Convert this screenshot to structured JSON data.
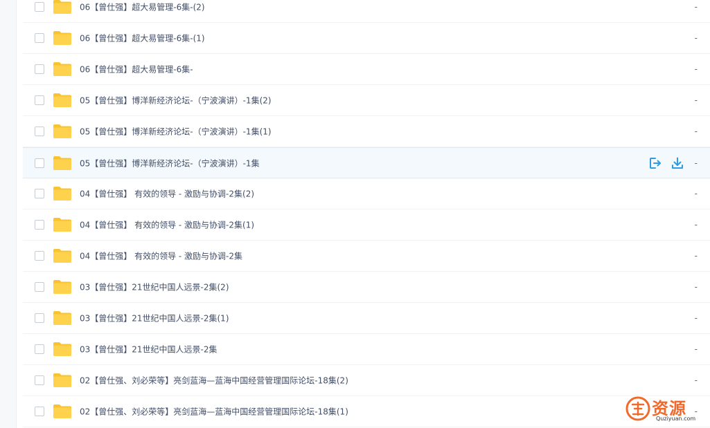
{
  "files": [
    {
      "name": "06【曾仕强】超大易管理-6集-(2)",
      "size": "-"
    },
    {
      "name": "06【曾仕强】超大易管理-6集-(1)",
      "size": "-"
    },
    {
      "name": "06【曾仕强】超大易管理-6集-",
      "size": "-"
    },
    {
      "name": "05【曾仕强】博洋新经济论坛-（宁波演讲）-1集(2)",
      "size": "-"
    },
    {
      "name": "05【曾仕强】博洋新经济论坛-（宁波演讲）-1集(1)",
      "size": "-"
    },
    {
      "name": "05【曾仕强】博洋新经济论坛-（宁波演讲）-1集",
      "size": "-"
    },
    {
      "name": "04【曾仕强】 有效的领导 - 激励与协调-2集(2)",
      "size": "-"
    },
    {
      "name": "04【曾仕强】 有效的领导 - 激励与协调-2集(1)",
      "size": "-"
    },
    {
      "name": "04【曾仕强】 有效的领导 - 激励与协调-2集",
      "size": "-"
    },
    {
      "name": "03【曾仕强】21世纪中国人远景-2集(2)",
      "size": "-"
    },
    {
      "name": "03【曾仕强】21世纪中国人远景-2集(1)",
      "size": "-"
    },
    {
      "name": "03【曾仕强】21世纪中国人远景-2集",
      "size": "-"
    },
    {
      "name": "02【曾仕强、刘必荣等】亮剑蓝海—蓝海中国经营管理国际论坛-18集(2)",
      "size": "-"
    },
    {
      "name": "02【曾仕强、刘必荣等】亮剑蓝海—蓝海中国经营管理国际论坛-18集(1)",
      "size": "-"
    }
  ],
  "watermark": {
    "title": "资源",
    "subtitle": "Quziyuan.com"
  },
  "colors": {
    "folder": "#ffd24d",
    "folder_back": "#f9c22e",
    "accent": "#2b9be8",
    "watermark": "#f06a2b"
  },
  "icons": {
    "share": "share-icon",
    "download": "download-icon",
    "folder": "folder-icon"
  }
}
